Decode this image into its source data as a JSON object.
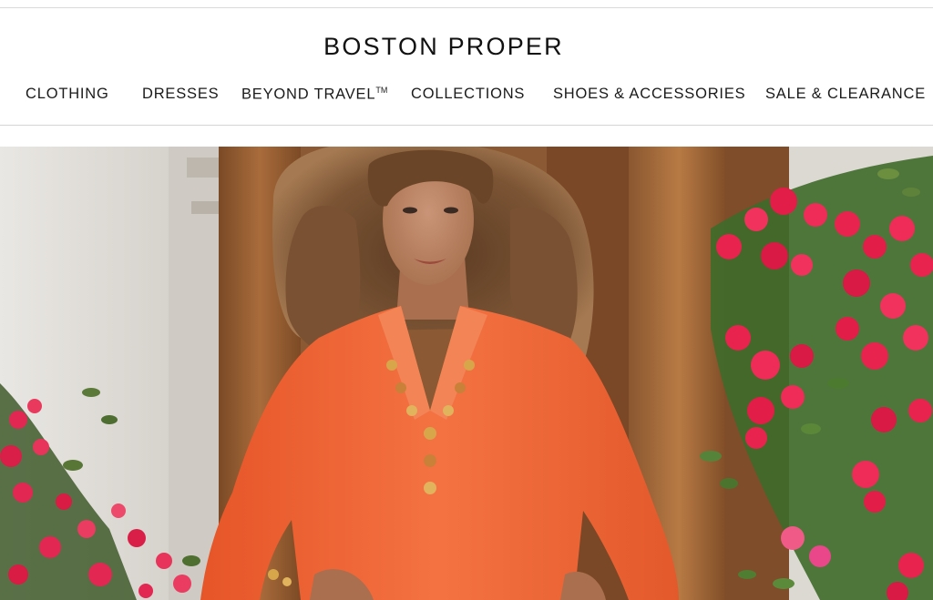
{
  "brand": {
    "name": "BOSTON PROPER"
  },
  "nav": {
    "items": [
      {
        "label": "CLOTHING"
      },
      {
        "label": "DRESSES"
      },
      {
        "label": "BEYOND TRAVEL",
        "mark": "TM"
      },
      {
        "label": "COLLECTIONS"
      },
      {
        "label": "SHOES & ACCESSORIES"
      },
      {
        "label": "SALE & CLEARANCE"
      }
    ]
  },
  "hero": {
    "subject": "model-in-orange-embellished-tunic",
    "colors": {
      "tunic": "#f0652f",
      "flowers": "#e8234e",
      "wall": "#e6e3df",
      "column": "#a86a3a"
    }
  }
}
